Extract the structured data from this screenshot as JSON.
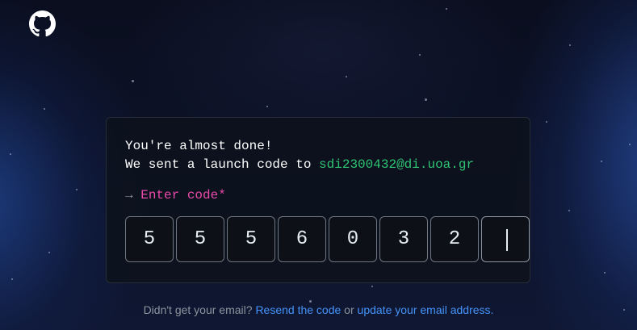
{
  "header": {
    "logo_icon": "github-octocat-icon"
  },
  "card": {
    "line1": "You're almost done!",
    "line2_prefix": "We sent a launch code to ",
    "email": "sdi2300432@di.uoa.gr",
    "prompt_arrow": "→",
    "prompt_label": "Enter code*"
  },
  "code_inputs": {
    "digits": [
      "5",
      "5",
      "5",
      "6",
      "0",
      "3",
      "2",
      ""
    ],
    "active_index": 7
  },
  "footer": {
    "prefix": "Didn't get your email? ",
    "resend_link": "Resend the code",
    "middle": " or ",
    "update_link": "update your email address",
    "suffix": "."
  },
  "colors": {
    "background": "#0c1228",
    "email_green": "#2fc474",
    "prompt_pink": "#ea4aaa",
    "link_blue": "#4493f8",
    "muted_gray": "#8b949e"
  }
}
